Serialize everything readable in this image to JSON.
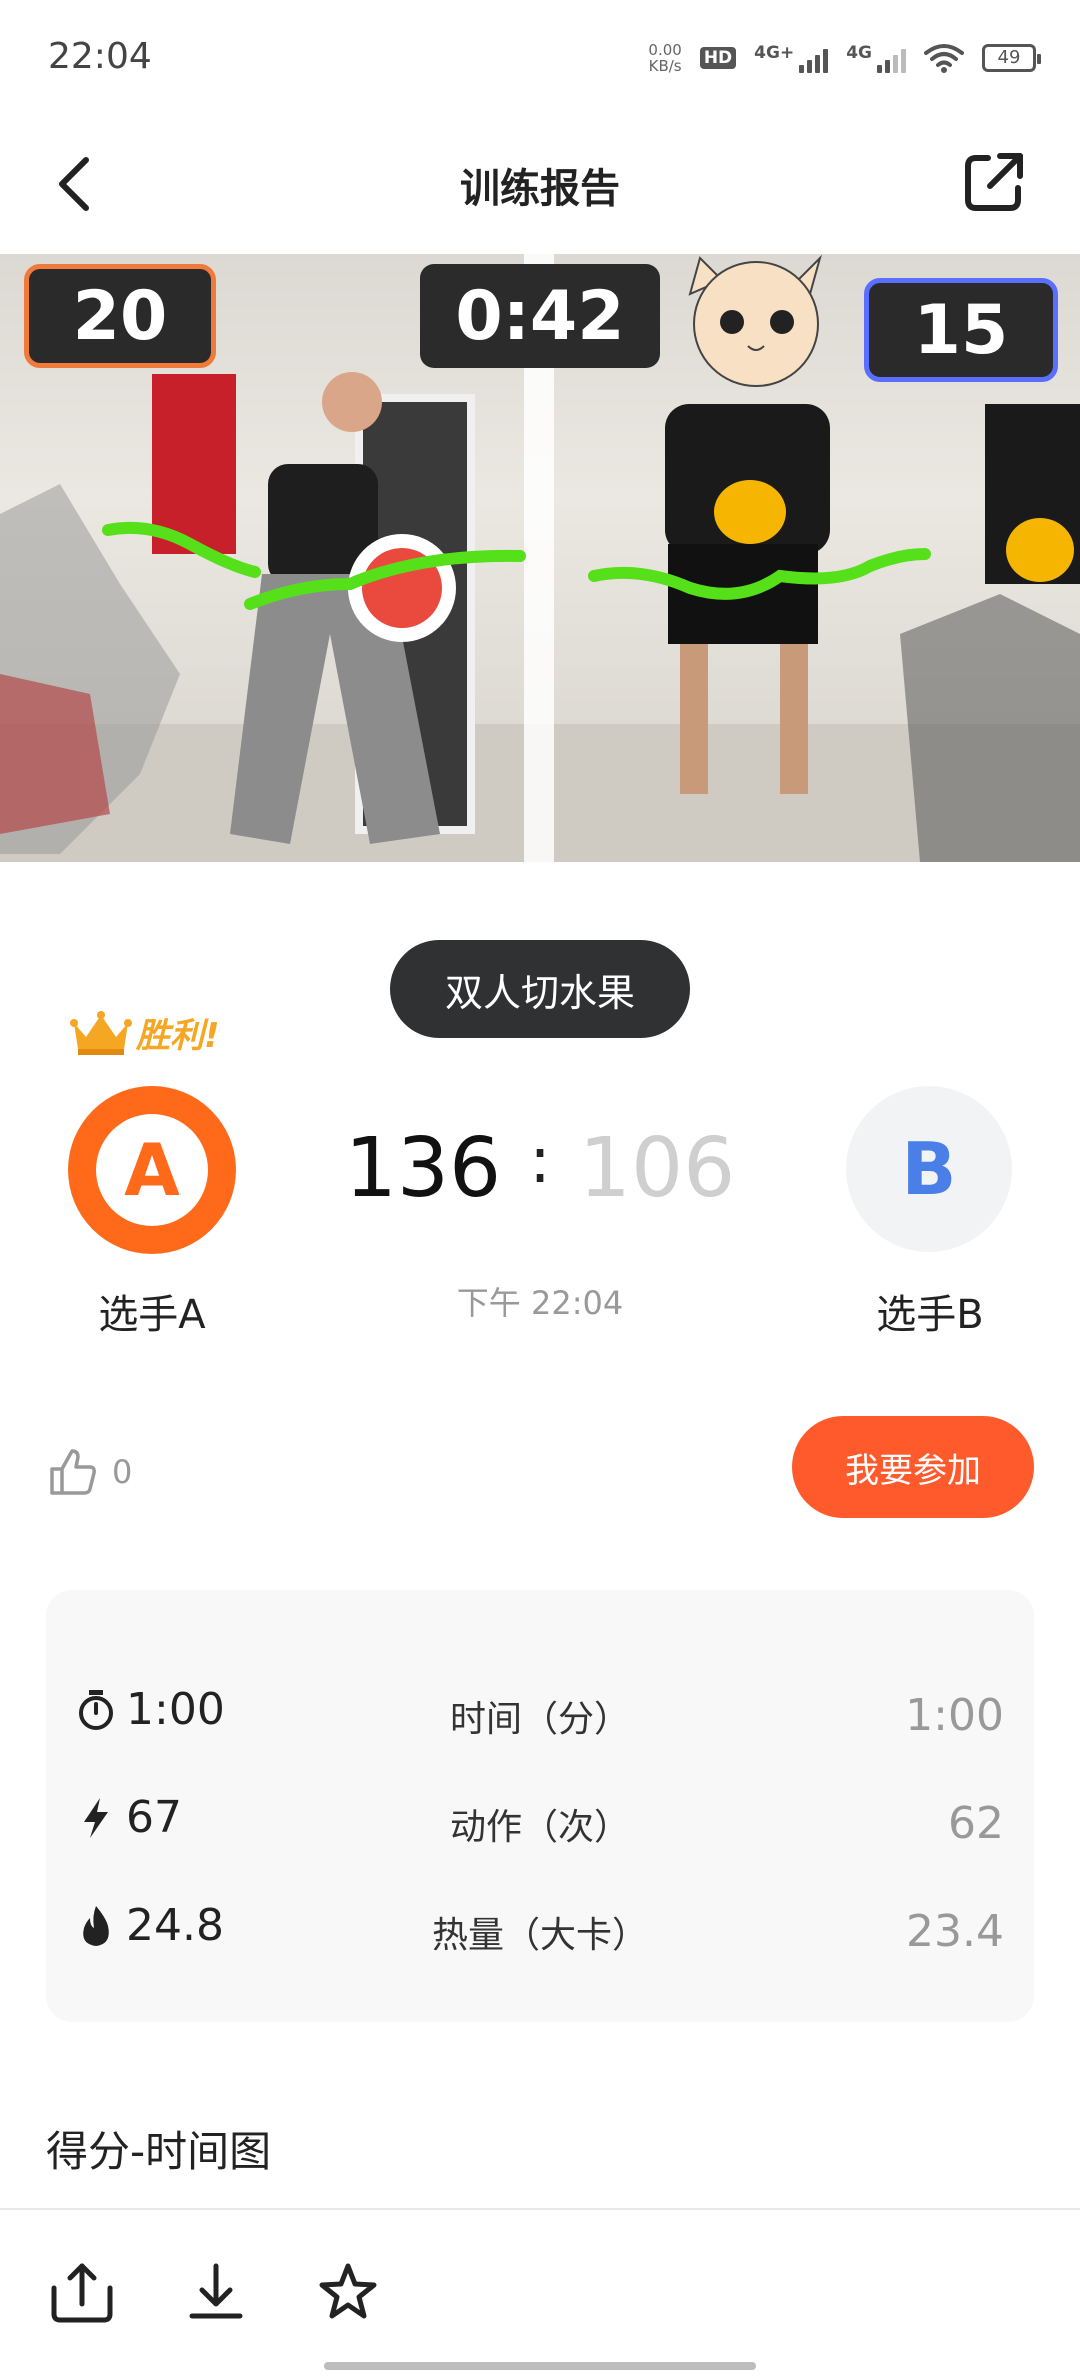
{
  "status_bar": {
    "time": "22:04",
    "net_speed_value": "0.00",
    "net_speed_unit": "KB/s",
    "hd_label": "HD",
    "sim1_label": "4G+",
    "sim2_label": "4G",
    "battery": "49"
  },
  "header": {
    "title": "训练报告"
  },
  "video": {
    "score_left": "20",
    "timer": "0:42",
    "score_right": "15"
  },
  "game": {
    "mode": "双人切水果",
    "winner_label": "胜利!",
    "player_a": {
      "avatar_letter": "A",
      "name": "选手A",
      "score": "136"
    },
    "player_b": {
      "avatar_letter": "B",
      "name": "选手B",
      "score": "106"
    },
    "score_separator": ":",
    "time_text": "下午 22:04"
  },
  "actions": {
    "like_count": "0",
    "join_label": "我要参加"
  },
  "stats": [
    {
      "icon": "stopwatch-icon",
      "a": "1:00",
      "label": "时间（分）",
      "b": "1:00"
    },
    {
      "icon": "lightning-icon",
      "a": "67",
      "label": "动作（次）",
      "b": "62"
    },
    {
      "icon": "flame-icon",
      "a": "24.8",
      "label": "热量（大卡）",
      "b": "23.4"
    }
  ],
  "chart_section": {
    "title": "得分-时间图"
  },
  "colors": {
    "accent": "#ff5a2c",
    "player_a": "#ff6a1a",
    "player_b": "#4a7fe8",
    "winner": "#f5a623"
  }
}
